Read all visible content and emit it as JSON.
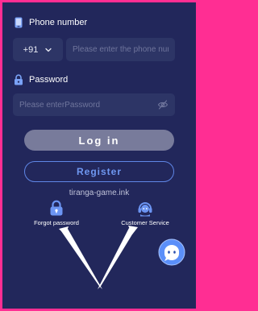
{
  "phone": {
    "label": "Phone number",
    "country_code": "+91",
    "placeholder": "Please enter the phone number",
    "value": ""
  },
  "password": {
    "label": "Password",
    "placeholder": "Please enterPassword",
    "value": ""
  },
  "buttons": {
    "login": "Log in",
    "register": "Register"
  },
  "domain_text": "tiranga-game.ink",
  "help_links": {
    "forgot": "Forgot password",
    "service": "Customer Service"
  },
  "icons": {
    "phone": "phone-icon",
    "password": "lock-icon",
    "country_dropdown": "chevron-down-icon",
    "visibility": "eye-off-icon",
    "forgot": "lock-icon",
    "service": "headset-icon",
    "chat": "chat-bot-icon"
  },
  "colors": {
    "frame_border": "#ff2e93",
    "background": "#22275b",
    "field_bg": "#2d3566",
    "accent_blue": "#5f86e6",
    "login_bg": "#787b9b",
    "annotation_arrow": "#ffffff"
  }
}
